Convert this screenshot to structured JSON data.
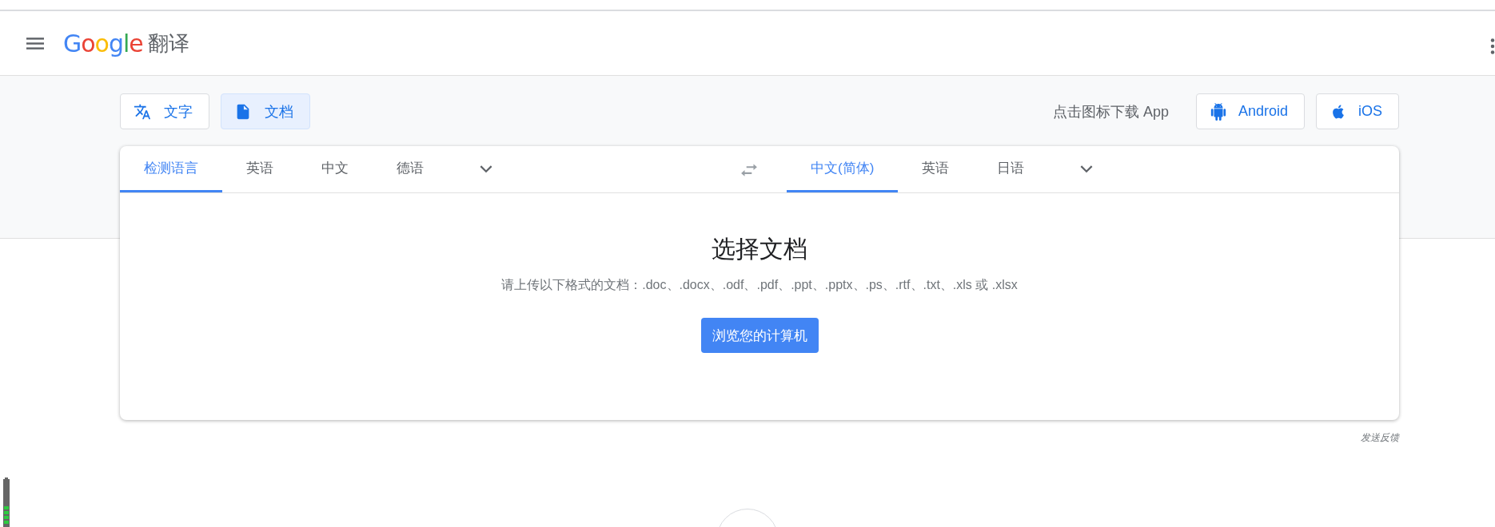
{
  "header": {
    "logo": "Google",
    "title": "翻译"
  },
  "modes": [
    {
      "label": "文字",
      "kind": "text",
      "selected": false
    },
    {
      "label": "文档",
      "kind": "document",
      "selected": true
    }
  ],
  "app_download": {
    "label": "点击图标下载 App",
    "buttons": [
      {
        "label": "Android",
        "kind": "android"
      },
      {
        "label": "iOS",
        "kind": "ios"
      }
    ]
  },
  "source_languages": [
    {
      "label": "检测语言",
      "selected": true
    },
    {
      "label": "英语",
      "selected": false
    },
    {
      "label": "中文",
      "selected": false
    },
    {
      "label": "德语",
      "selected": false
    }
  ],
  "target_languages": [
    {
      "label": "中文(简体)",
      "selected": true
    },
    {
      "label": "英语",
      "selected": false
    },
    {
      "label": "日语",
      "selected": false
    }
  ],
  "document": {
    "title": "选择文档",
    "hint": "请上传以下格式的文档：.doc、.docx、.odf、.pdf、.ppt、.pptx、.ps、.rtf、.txt、.xls 或 .xlsx",
    "button": "浏览您的计算机"
  },
  "feedback": "发送反馈"
}
